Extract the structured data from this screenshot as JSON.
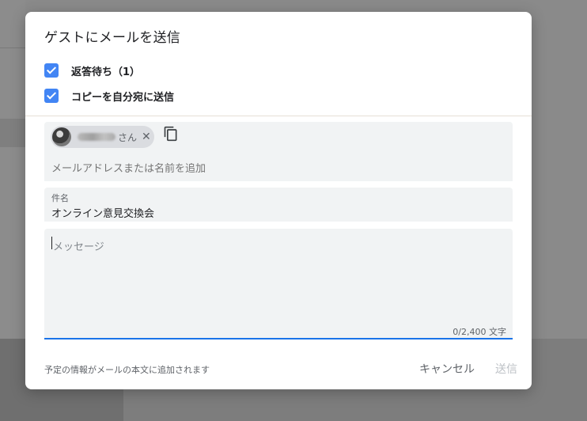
{
  "dialog": {
    "title": "ゲストにメールを送信",
    "options": [
      {
        "label": "返答待ち（1）",
        "checked": true
      },
      {
        "label": "コピーを自分宛に送信",
        "checked": true
      }
    ],
    "guests": {
      "chip_suffix": "さん",
      "placeholder": "メールアドレスまたは名前を追加"
    },
    "subject": {
      "label": "件名",
      "value": "オンライン意見交換会"
    },
    "message": {
      "placeholder": "メッセージ",
      "counter": "0/2,400 文字"
    },
    "footer": {
      "note": "予定の情報がメールの本文に追加されます",
      "cancel_label": "キャンセル",
      "send_label": "送信"
    }
  },
  "colors": {
    "accent": "#4285f4",
    "focus_underline": "#1a73e8",
    "field_bg": "#f1f3f4",
    "disabled_text": "#bdc1c6"
  },
  "icons": {
    "copy": "copy-icon",
    "close": "close-icon",
    "check": "check-icon"
  }
}
